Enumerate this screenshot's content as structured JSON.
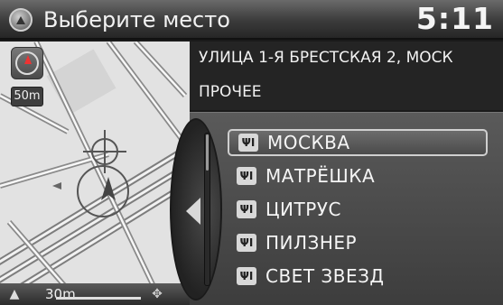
{
  "header": {
    "title": "Выберите место",
    "clock": "5:11"
  },
  "map": {
    "scale_badge": "50m",
    "bottom_scale": "30m"
  },
  "info": {
    "address": "УЛИЦА 1-Я БРЕСТСКАЯ 2, МОСК",
    "category": "ПРОЧЕЕ"
  },
  "list": {
    "items": [
      {
        "label": "МОСКВА",
        "selected": true
      },
      {
        "label": "МАТРЁШКА",
        "selected": false
      },
      {
        "label": "ЦИТРУС",
        "selected": false
      },
      {
        "label": "ПИЛЗНЕР",
        "selected": false
      },
      {
        "label": "СВЕТ ЗВЕЗД",
        "selected": false
      }
    ]
  },
  "icons": {
    "header": "navigation-icon",
    "poi": "restaurant-icon",
    "compass": "compass-icon",
    "map_left": "vehicle-icon",
    "map_right": "zoom-icon"
  },
  "colors": {
    "header_bg": "#3b3b3b",
    "map_bg": "#e4e4e4",
    "road": "#8a8a8a",
    "highlight_road": "#ffffff"
  }
}
